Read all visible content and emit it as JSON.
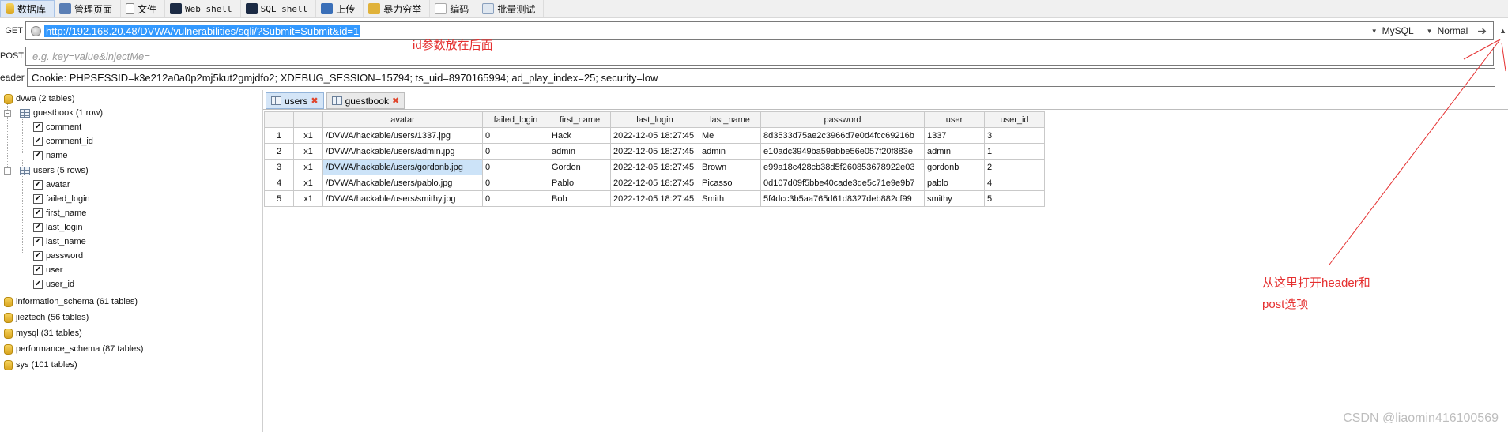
{
  "toolbar": {
    "items": [
      {
        "label": "数据库",
        "icon": "database-icon",
        "active": true
      },
      {
        "label": "管理页面",
        "icon": "manage-page-icon"
      },
      {
        "label": "文件",
        "icon": "file-icon"
      },
      {
        "label": "Web shell",
        "icon": "web-shell-icon"
      },
      {
        "label": "SQL shell",
        "icon": "sql-shell-icon"
      },
      {
        "label": "上传",
        "icon": "upload-icon"
      },
      {
        "label": "暴力穷举",
        "icon": "brute-force-icon"
      },
      {
        "label": "编码",
        "icon": "encode-icon"
      },
      {
        "label": "批量测试",
        "icon": "batch-test-icon"
      }
    ]
  },
  "request": {
    "get_label": "GET",
    "url": "http://192.168.20.48/DVWA/vulnerabilities/sqli/?Submit=Submit&id=1",
    "db_type": "MySQL",
    "mode": "Normal",
    "post_label": "POST",
    "post_placeholder": "e.g. key=value&injectMe=",
    "header_label": "eader",
    "header_value": "Cookie: PHPSESSID=k3e212a0a0p2mj5kut2gmjdfo2; XDEBUG_SESSION=15794; ts_uid=8970165994; ad_play_index=25; security=low"
  },
  "tree": {
    "dbs": [
      {
        "label": "dvwa (2 tables)"
      },
      {
        "label": "information_schema (61 tables)"
      },
      {
        "label": "jieztech (56 tables)"
      },
      {
        "label": "mysql (31 tables)"
      },
      {
        "label": "performance_schema (87 tables)"
      },
      {
        "label": "sys (101 tables)"
      }
    ],
    "tables": [
      {
        "label": "guestbook (1 row)",
        "columns": [
          "comment",
          "comment_id",
          "name"
        ]
      },
      {
        "label": "users (5 rows)",
        "columns": [
          "avatar",
          "failed_login",
          "first_name",
          "last_login",
          "last_name",
          "password",
          "user",
          "user_id"
        ]
      }
    ]
  },
  "tabs": [
    {
      "label": "users",
      "active": true
    },
    {
      "label": "guestbook",
      "active": false
    }
  ],
  "grid": {
    "columns": [
      "avatar",
      "failed_login",
      "first_name",
      "last_login",
      "last_name",
      "password",
      "user",
      "user_id"
    ],
    "rows": [
      {
        "n": "1",
        "x": "x1",
        "cells": [
          "/DVWA/hackable/users/1337.jpg",
          "0",
          "Hack",
          "2022-12-05 18:27:45",
          "Me",
          "8d3533d75ae2c3966d7e0d4fcc69216b",
          "1337",
          "3"
        ]
      },
      {
        "n": "2",
        "x": "x1",
        "cells": [
          "/DVWA/hackable/users/admin.jpg",
          "0",
          "admin",
          "2022-12-05 18:27:45",
          "admin",
          "e10adc3949ba59abbe56e057f20f883e",
          "admin",
          "1"
        ]
      },
      {
        "n": "3",
        "x": "x1",
        "cells": [
          "/DVWA/hackable/users/gordonb.jpg",
          "0",
          "Gordon",
          "2022-12-05 18:27:45",
          "Brown",
          "e99a18c428cb38d5f260853678922e03",
          "gordonb",
          "2"
        ]
      },
      {
        "n": "4",
        "x": "x1",
        "cells": [
          "/DVWA/hackable/users/pablo.jpg",
          "0",
          "Pablo",
          "2022-12-05 18:27:45",
          "Picasso",
          "0d107d09f5bbe40cade3de5c71e9e9b7",
          "pablo",
          "4"
        ]
      },
      {
        "n": "5",
        "x": "x1",
        "cells": [
          "/DVWA/hackable/users/smithy.jpg",
          "0",
          "Bob",
          "2022-12-05 18:27:45",
          "Smith",
          "5f4dcc3b5aa765d61d8327deb882cf99",
          "smithy",
          "5"
        ]
      }
    ]
  },
  "annotations": {
    "id_note": "id参数放在后面",
    "open_note_line1": "从这里打开header和",
    "open_note_line2": "post选项"
  },
  "watermark": "CSDN @liaomin416100569",
  "colors": {
    "annotation": "#e53030",
    "selection": "#3399ff"
  }
}
